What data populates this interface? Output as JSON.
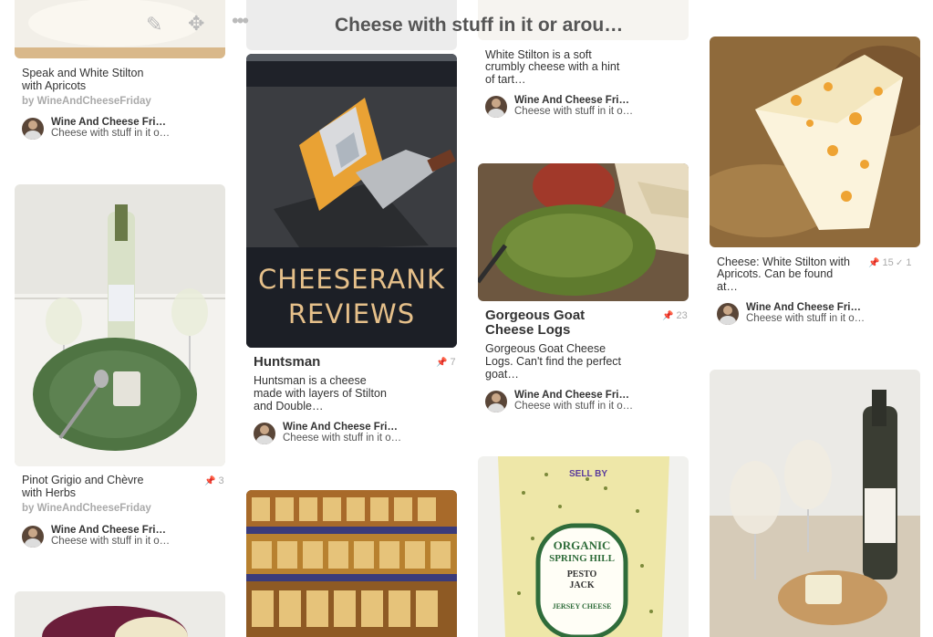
{
  "header": {
    "board_title": "Cheese with stuff in it or arou…",
    "icons": [
      "pencil-icon",
      "move-arrows-icon",
      "more-dots-icon"
    ]
  },
  "colors": {
    "accent_title": "#555555",
    "meta_gray": "#aaaaaa"
  },
  "pins": {
    "p1": {
      "title": "Speak and White Stilton",
      "title2": "with Apricots",
      "by": "by WineAndCheeseFriday",
      "owner": "Wine And Cheese Fri…",
      "board": "Cheese with stuff in it o…"
    },
    "p2": {
      "image_line1": "CHEESERANK",
      "image_line2": "REVIEWS",
      "title": "Huntsman",
      "repins": "7",
      "desc1": "Huntsman is a cheese",
      "desc2": "made with layers of Stilton",
      "desc3": "and Double…",
      "owner": "Wine And Cheese Fri…",
      "board": "Cheese with stuff in it o…"
    },
    "p3": {
      "desc1": "White Stilton is a soft",
      "desc2": "crumbly cheese with a hint",
      "desc3": "of tart…",
      "owner": "Wine And Cheese Fri…",
      "board": "Cheese with stuff in it o…"
    },
    "p4": {
      "desc1": "Cheese: White Stilton with",
      "desc2": "Apricots. Can be found",
      "desc3": "at…",
      "repins": "15",
      "likes": "1",
      "owner": "Wine And Cheese Fri…",
      "board": "Cheese with stuff in it o…"
    },
    "p5": {
      "title": "Pinot Grigio and Chèvre",
      "title2": "with Herbs",
      "repins": "3",
      "by": "by WineAndCheeseFriday",
      "owner": "Wine And Cheese Fri…",
      "board": "Cheese with stuff in it o…"
    },
    "p6": {
      "title1": "Gorgeous Goat",
      "title2": "Cheese Logs",
      "repins": "23",
      "desc1": "Gorgeous Goat Cheese",
      "desc2": "Logs. Can't find the perfect",
      "desc3": "goat…",
      "owner": "Wine And Cheese Fri…",
      "board": "Cheese with stuff in it o…"
    },
    "p7": {
      "label_top": "SELL BY",
      "label_brand1": "ORGANIC",
      "label_brand2": "SPRING HILL",
      "label_brand3": "PESTO",
      "label_brand4": "JACK",
      "label_brand5": "JERSEY CHEESE"
    }
  }
}
